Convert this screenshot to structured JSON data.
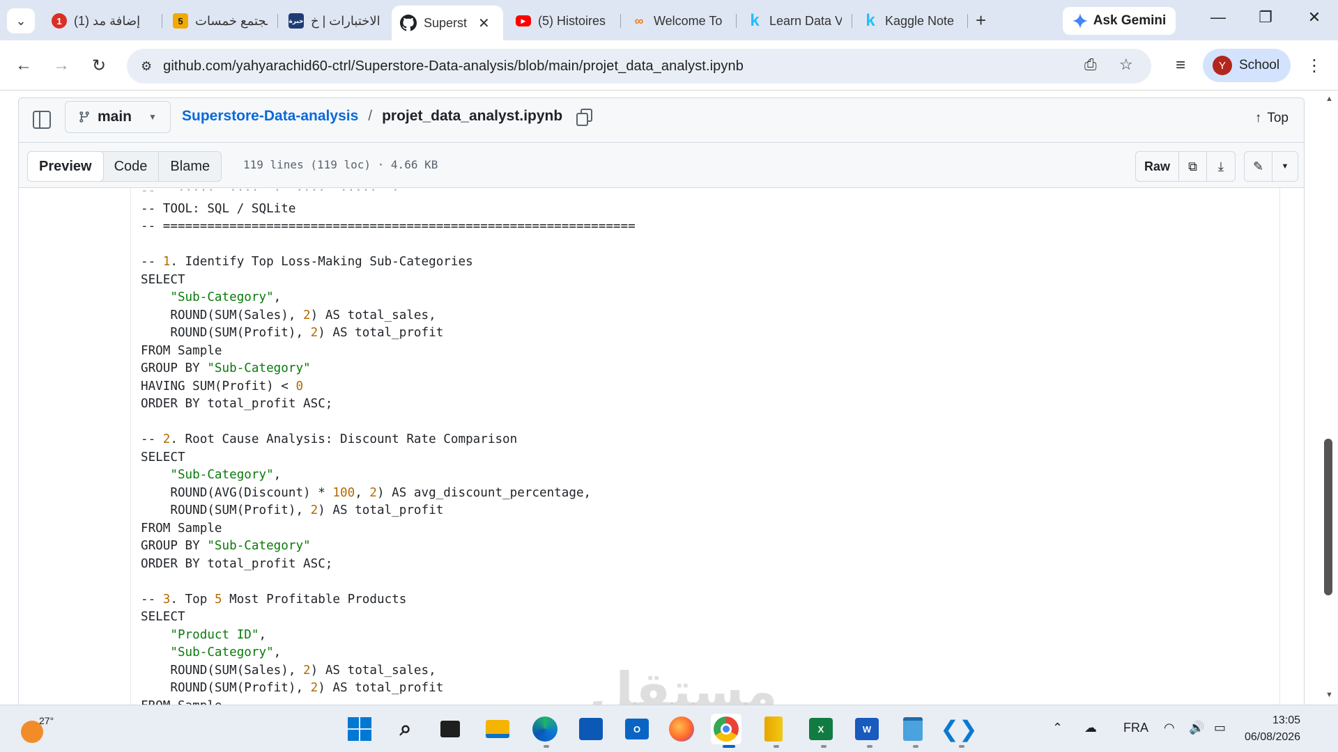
{
  "browser": {
    "tabs": [
      {
        "title": "(1) إضافة مد",
        "favicon": "hsoub-badge-icon",
        "color": "#d93025"
      },
      {
        "title": "مجتمع خمسات",
        "favicon": "khamsat-icon",
        "color": "#f2a900"
      },
      {
        "title": "الاختبارات | خ",
        "favicon": "khabra-icon",
        "color": "#1f3b73"
      },
      {
        "title": "Superst",
        "favicon": "github-icon",
        "color": "#1f2328",
        "active": true
      },
      {
        "title": "(5) Histoires",
        "favicon": "youtube-icon",
        "color": "#ff0000"
      },
      {
        "title": "Welcome To",
        "favicon": "coursera-icon",
        "color": "#f27c1c"
      },
      {
        "title": "Learn Data V",
        "favicon": "kaggle-icon",
        "color": "#20beff"
      },
      {
        "title": "Kaggle Note",
        "favicon": "kaggle-icon",
        "color": "#20beff"
      }
    ],
    "ask_gemini": "Ask Gemini",
    "url": "github.com/yahyarachid60-ctrl/Superstore-Data-analysis/blob/main/projet_data_analyst.ipynb",
    "profile_initial": "Y",
    "profile_name": "School"
  },
  "github": {
    "branch": "main",
    "repo": "Superstore-Data-analysis",
    "separator": "/",
    "file": "projet_data_analyst.ipynb",
    "top_label": "Top",
    "views": {
      "preview": "Preview",
      "code": "Code",
      "blame": "Blame"
    },
    "file_meta": "119 lines (119 loc) · 4.66 KB",
    "raw_label": "Raw"
  },
  "code_lines": [
    "-- TOOL: SQL / SQLite",
    "-- ================================================================",
    "",
    "-- 1. Identify Top Loss-Making Sub-Categories",
    "SELECT",
    "    \"Sub-Category\",",
    "    ROUND(SUM(Sales), 2) AS total_sales,",
    "    ROUND(SUM(Profit), 2) AS total_profit",
    "FROM Sample",
    "GROUP BY \"Sub-Category\"",
    "HAVING SUM(Profit) < 0",
    "ORDER BY total_profit ASC;",
    "",
    "-- 2. Root Cause Analysis: Discount Rate Comparison",
    "SELECT",
    "    \"Sub-Category\",",
    "    ROUND(AVG(Discount) * 100, 2) AS avg_discount_percentage,",
    "    ROUND(SUM(Profit), 2) AS total_profit",
    "FROM Sample",
    "GROUP BY \"Sub-Category\"",
    "ORDER BY total_profit ASC;",
    "",
    "-- 3. Top 5 Most Profitable Products",
    "SELECT",
    "    \"Product ID\",",
    "    \"Sub-Category\",",
    "    ROUND(SUM(Sales), 2) AS total_sales,",
    "    ROUND(SUM(Profit), 2) AS total_profit",
    "FROM Sample"
  ],
  "watermark": "مستقل",
  "taskbar": {
    "temperature": "27°",
    "language": "FRA",
    "time": "13:05",
    "date": "06/08/2026"
  }
}
